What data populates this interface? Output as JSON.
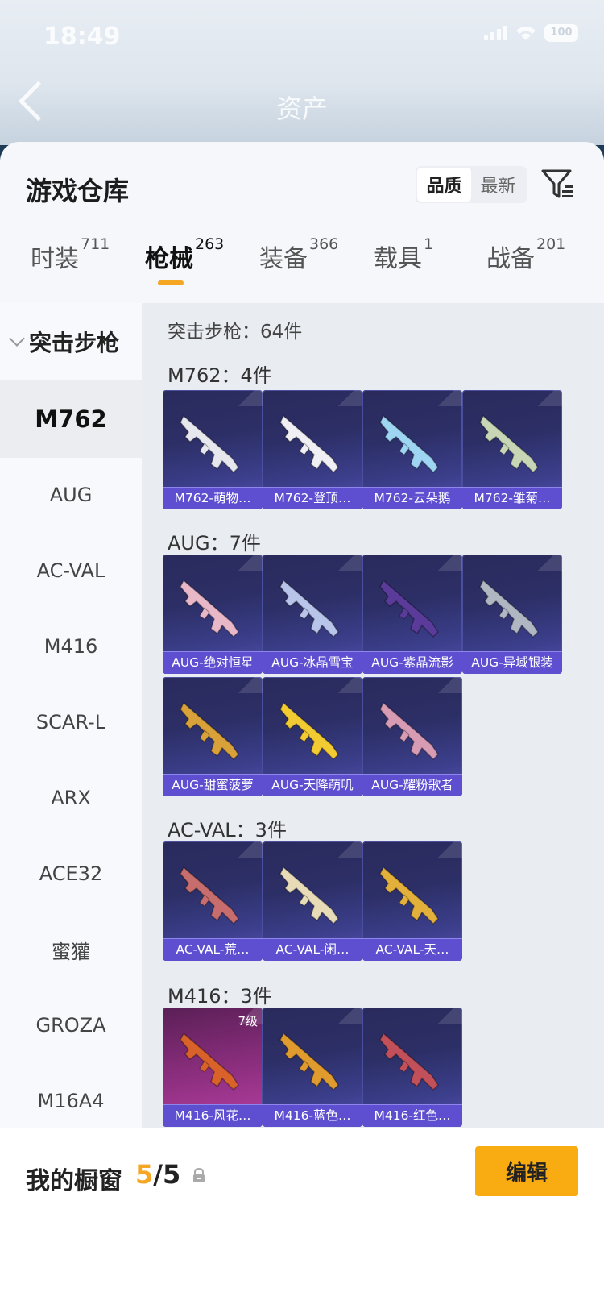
{
  "status_bar": {
    "time": "18:49",
    "battery": "100"
  },
  "header": {
    "title": "资产"
  },
  "warehouse": {
    "title": "游戏仓库",
    "sort_options": [
      "品质",
      "最新"
    ],
    "tabs": [
      {
        "label": "时装",
        "count": "711"
      },
      {
        "label": "枪械",
        "count": "263"
      },
      {
        "label": "装备",
        "count": "366"
      },
      {
        "label": "载具",
        "count": "1"
      },
      {
        "label": "战备",
        "count": "201"
      }
    ]
  },
  "sidebar": {
    "group": "突击步枪",
    "items": [
      "M762",
      "AUG",
      "AC-VAL",
      "M416",
      "SCAR-L",
      "ARX",
      "ACE32",
      "蜜獾",
      "GROZA",
      "M16A4"
    ]
  },
  "content": {
    "summary": "突击步枪：64件",
    "groups": [
      {
        "title": "M762：4件",
        "items": [
          "M762-萌物…",
          "M762-登顶…",
          "M762-云朵鹅",
          "M762-雏菊…"
        ]
      },
      {
        "title": "AUG：7件",
        "items": [
          "AUG-绝对恒星",
          "AUG-冰晶雪宝",
          "AUG-紫晶流影",
          "AUG-异域银装",
          "AUG-甜蜜菠萝",
          "AUG-天降萌叽",
          "AUG-耀粉歌者"
        ]
      },
      {
        "title": "AC-VAL：3件",
        "items": [
          "AC-VAL-荒…",
          "AC-VAL-闲…",
          "AC-VAL-天…"
        ]
      },
      {
        "title": "M416：3件",
        "items": [
          "M416-风花…",
          "M416-蓝色…",
          "M416-红色…"
        ],
        "badge": "7级"
      }
    ]
  },
  "bottom": {
    "label": "我的橱窗",
    "count_used": "5",
    "count_total": "/5",
    "edit": "编辑"
  },
  "colors": {
    "accent": "#f9ab12",
    "card_bg": "#2c2f66",
    "card_label": "#5d4fd0"
  }
}
